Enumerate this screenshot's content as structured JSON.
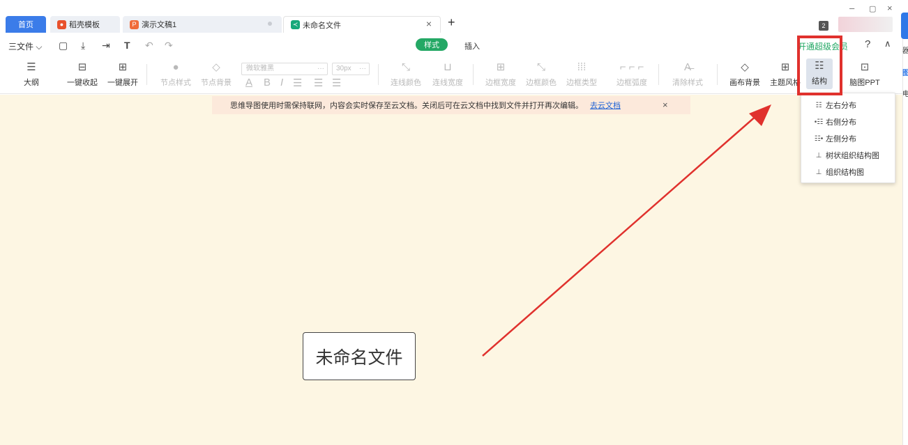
{
  "tabs": {
    "home": "首页",
    "daoke": "稻壳模板",
    "ppt": "演示文稿1",
    "mindmap": "未命名文件",
    "add": "+",
    "close": "×",
    "count": "2"
  },
  "window": {
    "minimize": "–",
    "maximize": "▢",
    "close": "×"
  },
  "menu": {
    "file": "三文件 ⌵",
    "ribbon_tabs": {
      "style": "样式",
      "insert": "插入"
    },
    "vip": "开通超级会员",
    "help": "?",
    "collapse": "∧"
  },
  "toolbar": {
    "outline": "大纲",
    "collapse_all": "一键收起",
    "expand_all": "一键展开",
    "node_style": "节点样式",
    "node_bg": "节点背景",
    "font_name": "微软雅黑",
    "font_size": "30px",
    "line_color": "连线颜色",
    "line_width": "连线宽度",
    "border_width": "边框宽度",
    "border_color": "边框颜色",
    "border_type": "边框类型",
    "border_radius": "边框弧度",
    "clear_style": "清除样式",
    "canvas_bg": "画布背景",
    "theme": "主题风格",
    "structure": "结构",
    "brain_ppt": "脑图PPT"
  },
  "banner": {
    "message": "思维导图使用时需保持联网，内容会实时保存至云文档。关闭后可在云文档中找到文件并打开再次编辑。",
    "link": "去云文档",
    "close": "×"
  },
  "canvas": {
    "root_node": "未命名文件"
  },
  "structure_menu": {
    "items": [
      {
        "icon": "☷",
        "label": "左右分布"
      },
      {
        "icon": "•☷",
        "label": "右侧分布"
      },
      {
        "icon": "☷•",
        "label": "左侧分布"
      },
      {
        "icon": "⊥",
        "label": "树状组织结构图"
      },
      {
        "icon": "⊥",
        "label": "组织结构图"
      }
    ]
  },
  "edge": {
    "c1": "器",
    "c2": "图",
    "c3": "电"
  },
  "colors": {
    "accent": "#24a865",
    "canvas": "#fdf6e3",
    "highlight": "#e0312d",
    "home_tab": "#3b7ce9"
  }
}
